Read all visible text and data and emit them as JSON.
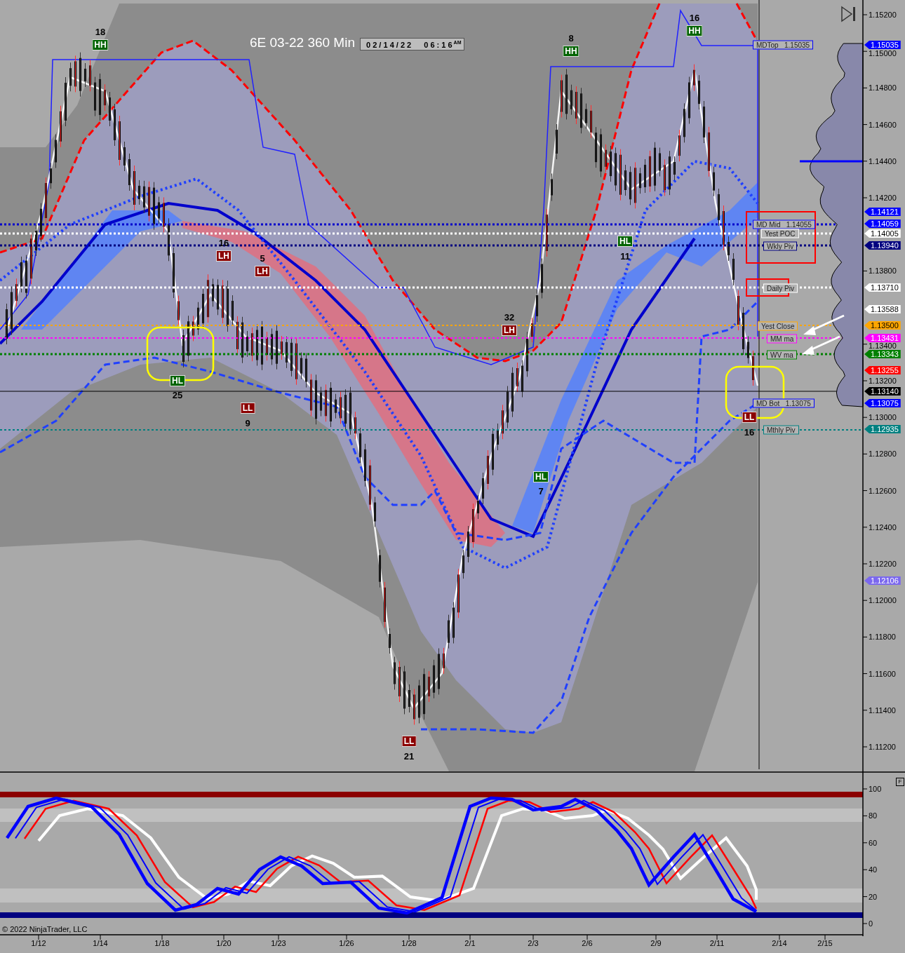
{
  "chart": {
    "title": "6E 03-22 360 Min",
    "date_box": {
      "date": "0 2 / 1 4 / 2 2",
      "time": "0 6 : 1 6",
      "ampm": "AM"
    },
    "swing_labels": [
      {
        "label": "HH",
        "count": "18",
        "kind": "high-green"
      },
      {
        "label": "LH",
        "count": "16",
        "kind": "high-red"
      },
      {
        "label": "LH",
        "count": "5",
        "kind": "high-red"
      },
      {
        "label": "HL",
        "count": "25",
        "kind": "low-green"
      },
      {
        "label": "LL",
        "count": "9",
        "kind": "low-red"
      },
      {
        "label": "LL",
        "count": "21",
        "kind": "low-red"
      },
      {
        "label": "LH",
        "count": "32",
        "kind": "high-red"
      },
      {
        "label": "HL",
        "count": "7",
        "kind": "low-green"
      },
      {
        "label": "HH",
        "count": "8",
        "kind": "high-green"
      },
      {
        "label": "HL",
        "count": "11",
        "kind": "low-green"
      },
      {
        "label": "HH",
        "count": "16",
        "kind": "high-green"
      },
      {
        "label": "LL",
        "count": "16",
        "kind": "low-red"
      }
    ],
    "level_labels": [
      {
        "text": "MDTop   1.15035",
        "color": "#0000ff"
      },
      {
        "text": "MD Mid   1.14055",
        "color": "#0000ff"
      },
      {
        "text": "Yest POC",
        "color": "#ffffff"
      },
      {
        "text": "Wkly Piv",
        "color": "#000080"
      },
      {
        "text": "Daily Piv",
        "color": "#ffffff"
      },
      {
        "text": "Yest Close",
        "color": "#ffa500"
      },
      {
        "text": "MM ma",
        "color": "#ff00ff"
      },
      {
        "text": "WV ma",
        "color": "#008000"
      },
      {
        "text": "MD Bot   1.13075",
        "color": "#0000ff"
      },
      {
        "text": "Mthly Piv",
        "color": "#008080"
      }
    ],
    "copyright": "© 2022 NinjaTrader, LLC"
  },
  "price_axis": {
    "ticks": [
      "1.15200",
      "1.15000",
      "1.14800",
      "1.14600",
      "1.14400",
      "1.14200",
      "1.13800",
      "1.13400",
      "1.13200",
      "1.13000",
      "1.12800",
      "1.12600",
      "1.12400",
      "1.12200",
      "1.12000",
      "1.11800",
      "1.11600",
      "1.11400",
      "1.11200"
    ],
    "tags": [
      {
        "text": "1.15035",
        "color": "#0000ff"
      },
      {
        "text": "1.14121",
        "color": "#0000ff"
      },
      {
        "text": "1.14059",
        "color": "#0000ff"
      },
      {
        "text": "1.14005",
        "color": "#ffffff"
      },
      {
        "text": "1.13940",
        "color": "#000080"
      },
      {
        "text": "1.13710",
        "color": "#ffffff"
      },
      {
        "text": "1.13588",
        "color": "#ffffff"
      },
      {
        "text": "1.13500",
        "color": "#ffa500"
      },
      {
        "text": "1.13431",
        "color": "#ff00ff"
      },
      {
        "text": "1.13343",
        "color": "#008000"
      },
      {
        "text": "1.13255",
        "color": "#ff0000"
      },
      {
        "text": "1.13140",
        "color": "#000000"
      },
      {
        "text": "1.13075",
        "color": "#0000ff"
      },
      {
        "text": "1.12935",
        "color": "#008080"
      },
      {
        "text": "1.12106",
        "color": "#7b68ee"
      }
    ]
  },
  "oscillator": {
    "ticks": [
      "100",
      "80",
      "60",
      "40",
      "20",
      "0"
    ],
    "panel_button": "F"
  },
  "time_axis": {
    "labels": [
      "1/12",
      "1/14",
      "1/18",
      "1/20",
      "1/23",
      "1/26",
      "1/28",
      "2/1",
      "2/3",
      "2/6",
      "2/9",
      "2/11",
      "2/14",
      "2/15"
    ]
  }
}
